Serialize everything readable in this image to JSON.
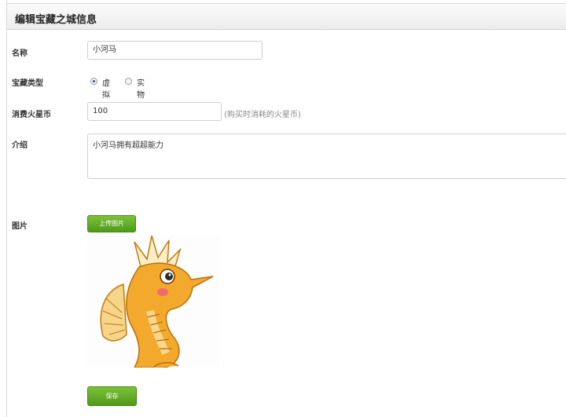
{
  "header": {
    "title": "编辑宝藏之城信息"
  },
  "form": {
    "name": {
      "label": "名称",
      "value": "小河马"
    },
    "type": {
      "label": "宝藏类型",
      "options": [
        {
          "label": "虚拟",
          "checked": true
        },
        {
          "label": "实物",
          "checked": false
        }
      ]
    },
    "coins": {
      "label": "消费火星币",
      "value": "100",
      "hint": "(购买时消耗的火星币)"
    },
    "intro": {
      "label": "介绍",
      "value": "小河马拥有超超能力"
    },
    "image": {
      "label": "图片",
      "upload_label": "上传图片",
      "preview_icon": "seahorse-image"
    },
    "save_label": "保存"
  },
  "colors": {
    "button_green": "#5aa820",
    "header_bg": "#f0f0f0",
    "seahorse_orange": "#f3a92c"
  }
}
